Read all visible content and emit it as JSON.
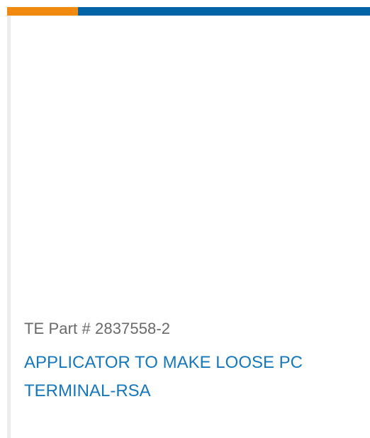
{
  "colors": {
    "accent_orange": "#f28a10",
    "accent_blue": "#0063a6",
    "title_link": "#1877b8",
    "part_text": "#6a6a6a"
  },
  "product": {
    "part_number_label": "TE Part # 2837558-2",
    "title": "APPLICATOR TO MAKE LOOSE PC TERMINAL-RSA"
  }
}
